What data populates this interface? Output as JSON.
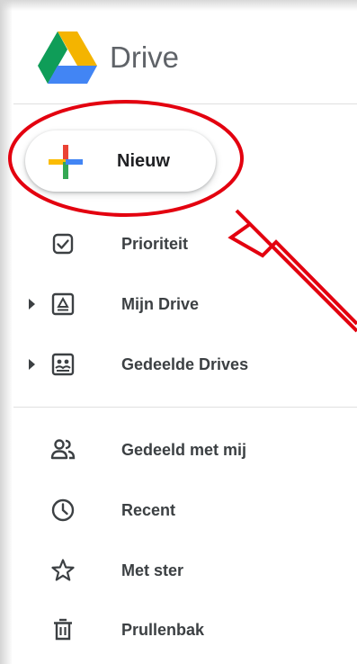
{
  "app": {
    "title": "Drive",
    "logo_icon": "google-drive-logo"
  },
  "new_button": {
    "label": "Nieuw",
    "icon": "colored-plus-icon"
  },
  "nav": {
    "items": [
      {
        "label": "Prioriteit",
        "icon": "checkbox-icon",
        "expandable": false
      },
      {
        "label": "Mijn Drive",
        "icon": "my-drive-icon",
        "expandable": true
      },
      {
        "label": "Gedeelde Drives",
        "icon": "shared-drives-icon",
        "expandable": true
      },
      {
        "label": "Gedeeld met mij",
        "icon": "people-icon",
        "expandable": false
      },
      {
        "label": "Recent",
        "icon": "clock-icon",
        "expandable": false
      },
      {
        "label": "Met ster",
        "icon": "star-icon",
        "expandable": false
      },
      {
        "label": "Prullenbak",
        "icon": "trash-icon",
        "expandable": false
      }
    ]
  },
  "colors": {
    "annotation_red": "#e3000f",
    "text_dark": "#3c4043",
    "title_gray": "#5f6368",
    "drive_green": "#0f9d58",
    "drive_yellow": "#f4b400",
    "drive_blue": "#4285f4",
    "plus_red": "#ea4335",
    "plus_yellow": "#fbbc04",
    "plus_green": "#34a853",
    "plus_blue": "#4285f4"
  }
}
